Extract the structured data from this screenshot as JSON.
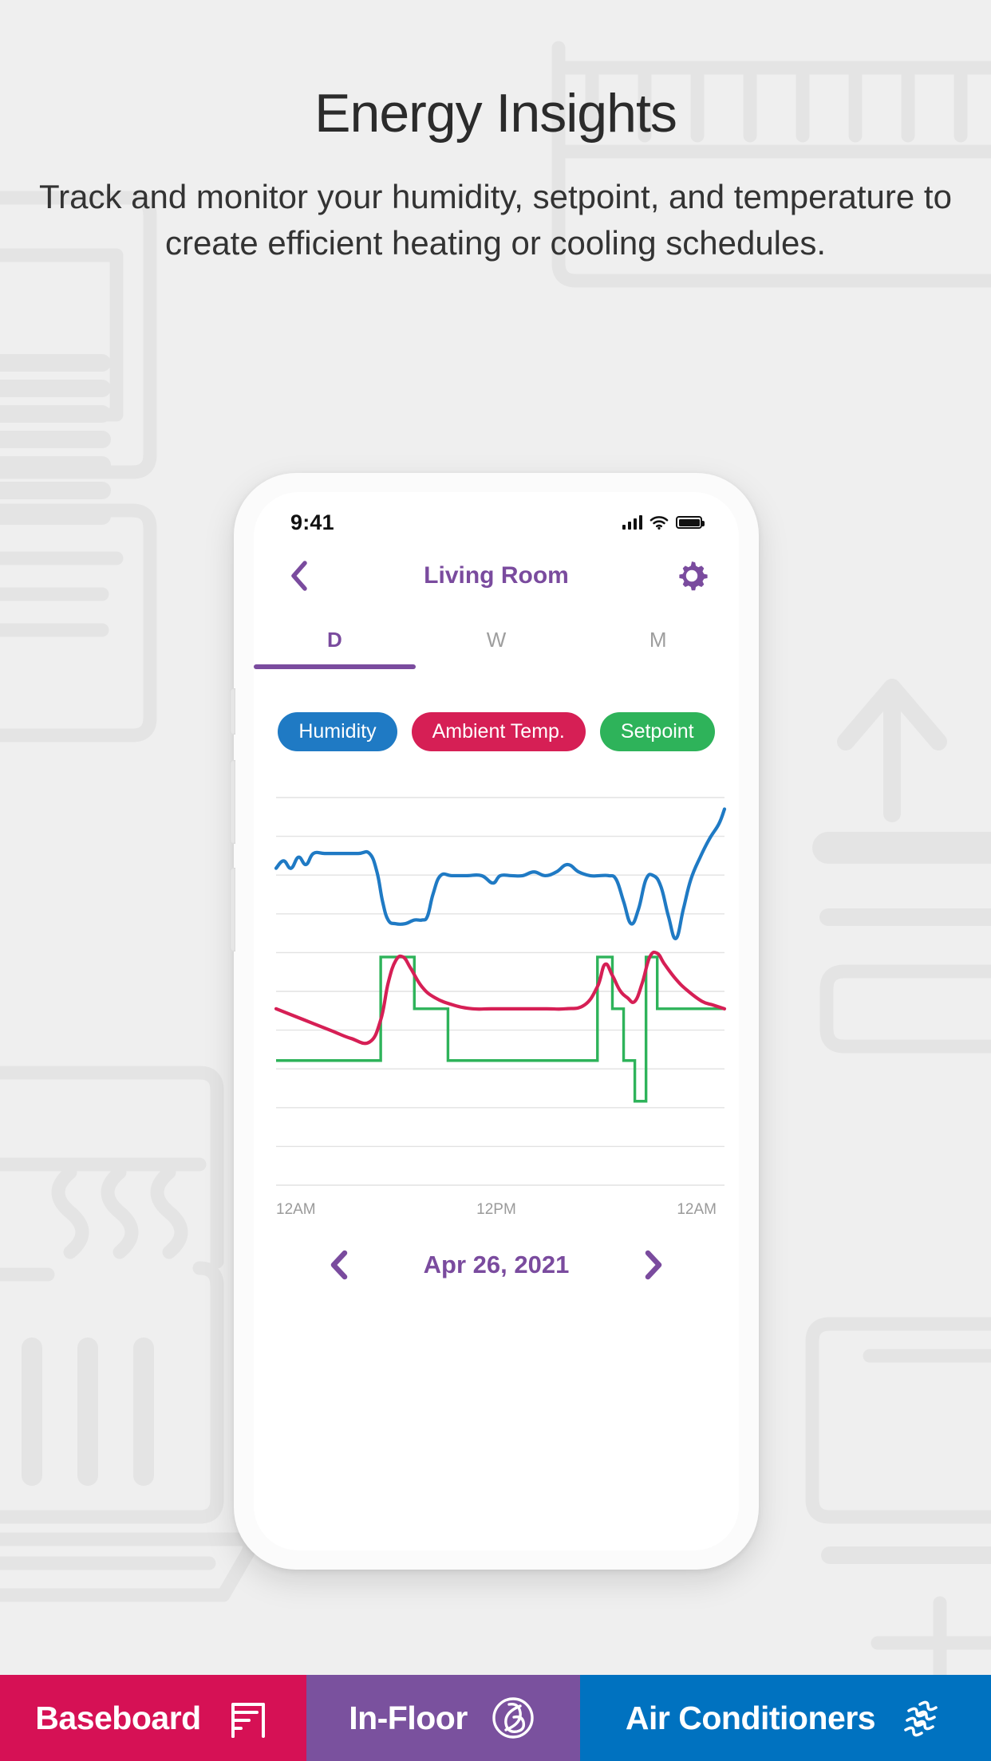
{
  "page": {
    "background_color": "#efefef",
    "title": "Energy Insights",
    "subtitle": "Track and monitor your humidity, setpoint, and temperature to create efficient heating or cooling schedules."
  },
  "colors": {
    "brand_purple": "#7a4b9e",
    "humidity_blue": "#1f7ac4",
    "ambient_crimson": "#d61f55",
    "setpoint_green": "#2eb35a",
    "baseboard_bar": "#d61155",
    "infloor_bar": "#7a519e",
    "ac_bar": "#0072c0",
    "gridline": "#e2e2e2",
    "tab_inactive": "#9e9e9e",
    "axis_label": "#9a9a9a"
  },
  "phone": {
    "statusbar": {
      "time": "9:41",
      "signal_icon": "cellular-signal-icon",
      "wifi_icon": "wifi-icon",
      "battery_icon": "battery-full-icon"
    },
    "navbar": {
      "back_icon": "chevron-left-icon",
      "title": "Living Room",
      "settings_icon": "gear-icon"
    },
    "tabs": [
      {
        "label": "D",
        "active": true
      },
      {
        "label": "W",
        "active": false
      },
      {
        "label": "M",
        "active": false
      }
    ],
    "legend": [
      {
        "label": "Humidity",
        "color": "#1f7ac4"
      },
      {
        "label": "Ambient Temp.",
        "color": "#d61f55"
      },
      {
        "label": "Setpoint",
        "color": "#2eb35a"
      }
    ],
    "date_nav": {
      "prev_icon": "chevron-left-icon",
      "date": "Apr 26, 2021",
      "next_icon": "chevron-right-icon"
    }
  },
  "bottom_bars": [
    {
      "label": "Baseboard",
      "color": "#d61155",
      "icon": "baseboard-heater-icon"
    },
    {
      "label": "In-Floor",
      "color": "#7a519e",
      "icon": "in-floor-coil-icon"
    },
    {
      "label": "Air Conditioners",
      "color": "#0072c0",
      "icon": "air-flow-icon"
    }
  ],
  "chart_data": {
    "type": "line",
    "title": "",
    "xlabel": "",
    "ylabel": "",
    "grid": true,
    "legend_position": "top",
    "x_ticks": [
      "12AM",
      "12PM",
      "12AM"
    ],
    "x_range": [
      0,
      24
    ],
    "y_gridlines": 11,
    "series": [
      {
        "name": "Humidity",
        "color": "#1f7ac4",
        "style": "smooth",
        "x": [
          0,
          0.4,
          0.8,
          1.2,
          1.6,
          2.0,
          2.6,
          3.4,
          4.4,
          5.0,
          5.4,
          5.7,
          6.0,
          6.4,
          6.9,
          7.4,
          7.8,
          8.1,
          8.4,
          8.8,
          9.4,
          10.2,
          11.0,
          11.6,
          12.0,
          12.6,
          13.2,
          13.8,
          14.4,
          15.0,
          15.6,
          16.2,
          16.8,
          17.3,
          17.8,
          18.2,
          18.6,
          19.0,
          19.4,
          19.8,
          20.2,
          20.6,
          21.0,
          21.4,
          21.8,
          22.2,
          22.7,
          23.2,
          23.7,
          24.0
        ],
        "y": [
          77,
          79,
          77,
          80,
          78,
          81,
          81,
          81,
          81,
          81,
          76,
          68,
          63,
          62,
          62,
          63,
          63,
          64,
          70,
          75,
          75,
          75,
          75,
          73,
          75,
          75,
          75,
          76,
          75,
          76,
          78,
          76,
          75,
          75,
          75,
          74,
          68,
          62,
          66,
          74,
          75,
          72,
          64,
          58,
          66,
          74,
          80,
          85,
          89,
          93
        ]
      },
      {
        "name": "Ambient Temp.",
        "color": "#d61f55",
        "style": "smooth",
        "x": [
          0,
          1,
          2,
          3,
          4,
          5,
          5.6,
          6.0,
          6.4,
          6.8,
          7.2,
          7.8,
          8.5,
          9.5,
          10.5,
          11.5,
          12.5,
          13.5,
          14.5,
          15.5,
          16.5,
          17.2,
          17.6,
          18.0,
          18.4,
          18.8,
          19.2,
          19.6,
          20.0,
          20.4,
          20.8,
          21.4,
          22.0,
          22.8,
          23.4,
          24.0
        ],
        "y": [
          39,
          37,
          35,
          33,
          31,
          30,
          36,
          46,
          52,
          53,
          50,
          45,
          42,
          40,
          39,
          39,
          39,
          39,
          39,
          39,
          40,
          45,
          51,
          48,
          44,
          42,
          41,
          46,
          53,
          54,
          51,
          47,
          44,
          41,
          40,
          39
        ]
      },
      {
        "name": "Setpoint",
        "color": "#2eb35a",
        "style": "step",
        "x": [
          0,
          5.6,
          5.6,
          7.4,
          7.4,
          9.2,
          9.2,
          17.2,
          17.2,
          18.0,
          18.0,
          18.6,
          18.6,
          19.2,
          19.2,
          19.8,
          19.8,
          20.4,
          20.4,
          24
        ],
        "y": [
          25,
          25,
          53,
          53,
          39,
          39,
          25,
          25,
          53,
          53,
          39,
          39,
          25,
          25,
          14,
          14,
          53,
          53,
          39,
          39
        ]
      }
    ]
  }
}
